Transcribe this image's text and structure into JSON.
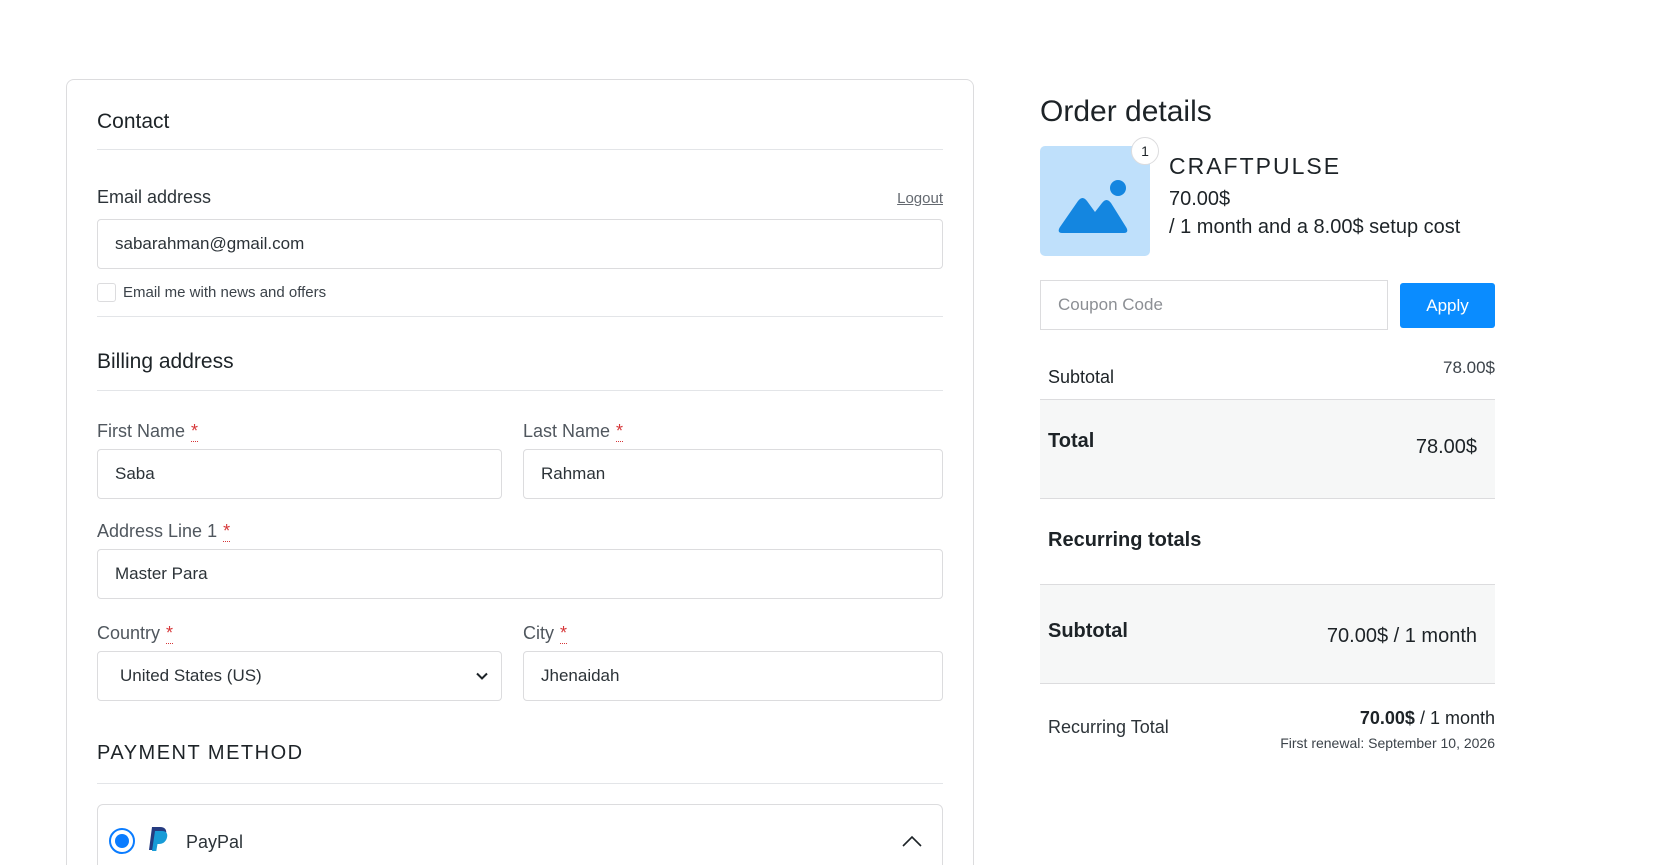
{
  "contact": {
    "title": "Contact",
    "email_label": "Email address",
    "logout_label": "Logout",
    "email_value": "sabarahman@gmail.com",
    "newsletter_label": "Email me with news and offers"
  },
  "billing": {
    "title": "Billing address",
    "required_mark": "*",
    "first_name_label": "First Name",
    "first_name_value": "Saba",
    "last_name_label": "Last Name",
    "last_name_value": "Rahman",
    "address_label": "Address Line 1",
    "address_value": "Master Para",
    "country_label": "Country",
    "country_value": "United States (US)",
    "city_label": "City",
    "city_value": "Jhenaidah"
  },
  "payment": {
    "title": "PAYMENT METHOD",
    "option_label": "PayPal"
  },
  "order": {
    "title": "Order details",
    "quantity": "1",
    "product_name": "CRAFTPULSE",
    "product_price": "70.00$",
    "product_terms": "/ 1 month and a 8.00$ setup cost",
    "coupon_placeholder": "Coupon Code",
    "apply_label": "Apply",
    "subtotal_label": "Subtotal",
    "subtotal_value": "78.00$",
    "total_label": "Total",
    "total_value": "78.00$",
    "recurring_title": "Recurring totals",
    "recurring_subtotal_label": "Subtotal",
    "recurring_subtotal_value": "70.00$ / 1 month",
    "recurring_total_label": "Recurring Total",
    "recurring_total_amount": "70.00$",
    "recurring_total_period": "/ 1 month",
    "first_renewal": "First renewal: September 10, 2026"
  },
  "colors": {
    "accent": "#0a8cff",
    "required": "#d63638",
    "thumb_bg": "#bfe0fb"
  }
}
